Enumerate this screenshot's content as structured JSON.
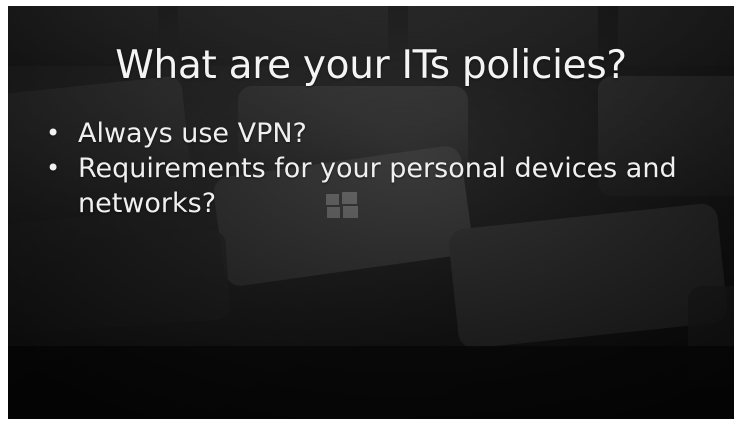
{
  "slide": {
    "title": "What are your ITs policies?",
    "bullets": [
      "Always use VPN?",
      "Requirements for your personal devices and networks?"
    ],
    "bullet_symbol": "•"
  },
  "colors": {
    "background": "#1a1a1a",
    "text": "#f4f4f4"
  }
}
